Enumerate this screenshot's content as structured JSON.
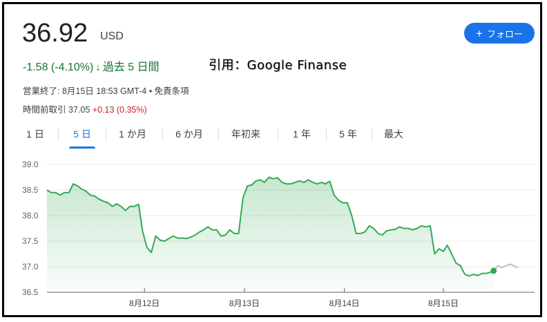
{
  "quote": {
    "price": "36.92",
    "currency": "USD",
    "change": "-1.58 (-4.10%)",
    "change_arrow": "↓",
    "period": "過去 5 日間",
    "market_status": "営業終了: 8月15日 18:53 GMT-4 • 免責条項",
    "after_hours_label": "時間前取引",
    "after_hours_price": "37.05",
    "after_hours_change": "+0.13 (0.35%)"
  },
  "watermark": "引用：Google Finanse",
  "follow_button": {
    "icon": "plus-icon",
    "label": "フォロー"
  },
  "tabs": [
    {
      "label": "1 日",
      "active": false
    },
    {
      "label": "5 日",
      "active": true
    },
    {
      "label": "1 か月",
      "active": false
    },
    {
      "label": "6 か月",
      "active": false
    },
    {
      "label": "年初来",
      "active": false
    },
    {
      "label": "1 年",
      "active": false
    },
    {
      "label": "5 年",
      "active": false
    },
    {
      "label": "最大",
      "active": false
    }
  ],
  "colors": {
    "line": "#34a853",
    "positive": "#137333",
    "negative": "#c5221f",
    "accent": "#1a73e8",
    "after_hours_line": "#bdbdbd"
  },
  "chart_data": {
    "type": "area",
    "ylim": [
      36.5,
      39.0
    ],
    "yticks": [
      "39.0",
      "38.5",
      "38.0",
      "37.5",
      "37.0",
      "36.5"
    ],
    "ytick_values": [
      39.0,
      38.5,
      38.0,
      37.5,
      37.0,
      36.5
    ],
    "xlim": [
      0,
      100
    ],
    "xtick_labels": [
      "8月12日",
      "8月13日",
      "8月14日",
      "8月15日"
    ],
    "xtick_positions": [
      20,
      40.5,
      61,
      81.3
    ],
    "grid": true,
    "series": [
      {
        "values": [
          [
            0,
            38.5
          ],
          [
            0.9,
            38.45
          ],
          [
            1.8,
            38.45
          ],
          [
            2.7,
            38.4
          ],
          [
            3.6,
            38.45
          ],
          [
            4.5,
            38.45
          ],
          [
            5.4,
            38.62
          ],
          [
            6.3,
            38.58
          ],
          [
            7.1,
            38.52
          ],
          [
            8.0,
            38.48
          ],
          [
            8.9,
            38.4
          ],
          [
            9.8,
            38.38
          ],
          [
            10.7,
            38.32
          ],
          [
            11.6,
            38.28
          ],
          [
            12.5,
            38.25
          ],
          [
            13.4,
            38.18
          ],
          [
            14.3,
            38.23
          ],
          [
            15.2,
            38.18
          ],
          [
            16.1,
            38.1
          ],
          [
            17.0,
            38.18
          ],
          [
            17.9,
            38.18
          ],
          [
            18.8,
            38.22
          ],
          [
            19.6,
            37.7
          ],
          [
            20.5,
            37.38
          ],
          [
            21.4,
            37.28
          ],
          [
            22.3,
            37.6
          ],
          [
            23.2,
            37.52
          ],
          [
            24.1,
            37.5
          ],
          [
            25.0,
            37.55
          ],
          [
            25.9,
            37.6
          ],
          [
            26.8,
            37.56
          ],
          [
            27.7,
            37.56
          ],
          [
            28.6,
            37.55
          ],
          [
            29.5,
            37.58
          ],
          [
            30.4,
            37.62
          ],
          [
            31.3,
            37.68
          ],
          [
            32.1,
            37.72
          ],
          [
            33.0,
            37.78
          ],
          [
            33.9,
            37.72
          ],
          [
            34.8,
            37.72
          ],
          [
            35.7,
            37.6
          ],
          [
            36.6,
            37.62
          ],
          [
            37.5,
            37.72
          ],
          [
            38.4,
            37.65
          ],
          [
            39.3,
            37.65
          ],
          [
            40.2,
            38.35
          ],
          [
            41.1,
            38.58
          ],
          [
            42.0,
            38.6
          ],
          [
            42.9,
            38.68
          ],
          [
            43.8,
            38.7
          ],
          [
            44.6,
            38.65
          ],
          [
            45.5,
            38.75
          ],
          [
            46.4,
            38.72
          ],
          [
            47.3,
            38.74
          ],
          [
            48.2,
            38.65
          ],
          [
            49.1,
            38.62
          ],
          [
            50.0,
            38.62
          ],
          [
            50.9,
            38.65
          ],
          [
            51.8,
            38.68
          ],
          [
            52.7,
            38.65
          ],
          [
            53.6,
            38.7
          ],
          [
            54.5,
            38.65
          ],
          [
            55.4,
            38.62
          ],
          [
            56.3,
            38.65
          ],
          [
            57.1,
            38.62
          ],
          [
            58.0,
            38.67
          ],
          [
            58.9,
            38.4
          ],
          [
            59.8,
            38.3
          ],
          [
            60.7,
            38.25
          ],
          [
            61.6,
            38.25
          ],
          [
            62.5,
            38.0
          ],
          [
            63.4,
            37.65
          ],
          [
            64.3,
            37.65
          ],
          [
            65.2,
            37.68
          ],
          [
            66.1,
            37.8
          ],
          [
            67.0,
            37.75
          ],
          [
            67.9,
            37.65
          ],
          [
            68.8,
            37.62
          ],
          [
            69.6,
            37.7
          ],
          [
            70.5,
            37.72
          ],
          [
            71.4,
            37.73
          ],
          [
            72.3,
            37.78
          ],
          [
            73.2,
            37.75
          ],
          [
            74.1,
            37.75
          ],
          [
            75.0,
            37.72
          ],
          [
            75.9,
            37.75
          ],
          [
            76.8,
            37.8
          ],
          [
            77.7,
            37.78
          ],
          [
            78.6,
            37.8
          ],
          [
            79.5,
            37.25
          ],
          [
            80.4,
            37.35
          ],
          [
            81.3,
            37.3
          ],
          [
            82.1,
            37.42
          ],
          [
            83.0,
            37.25
          ],
          [
            83.9,
            37.07
          ],
          [
            84.8,
            37.02
          ],
          [
            85.7,
            36.85
          ],
          [
            86.6,
            36.82
          ],
          [
            87.5,
            36.85
          ],
          [
            88.4,
            36.83
          ],
          [
            89.3,
            36.87
          ],
          [
            90.2,
            36.87
          ],
          [
            91.1,
            36.9
          ],
          [
            91.6,
            36.92
          ]
        ]
      },
      {
        "values": [
          [
            91.6,
            36.92
          ],
          [
            92.5,
            37.02
          ],
          [
            93.3,
            36.98
          ],
          [
            94.2,
            37.02
          ],
          [
            95.0,
            37.05
          ],
          [
            95.7,
            37.02
          ],
          [
            96.5,
            36.98
          ]
        ]
      }
    ]
  }
}
